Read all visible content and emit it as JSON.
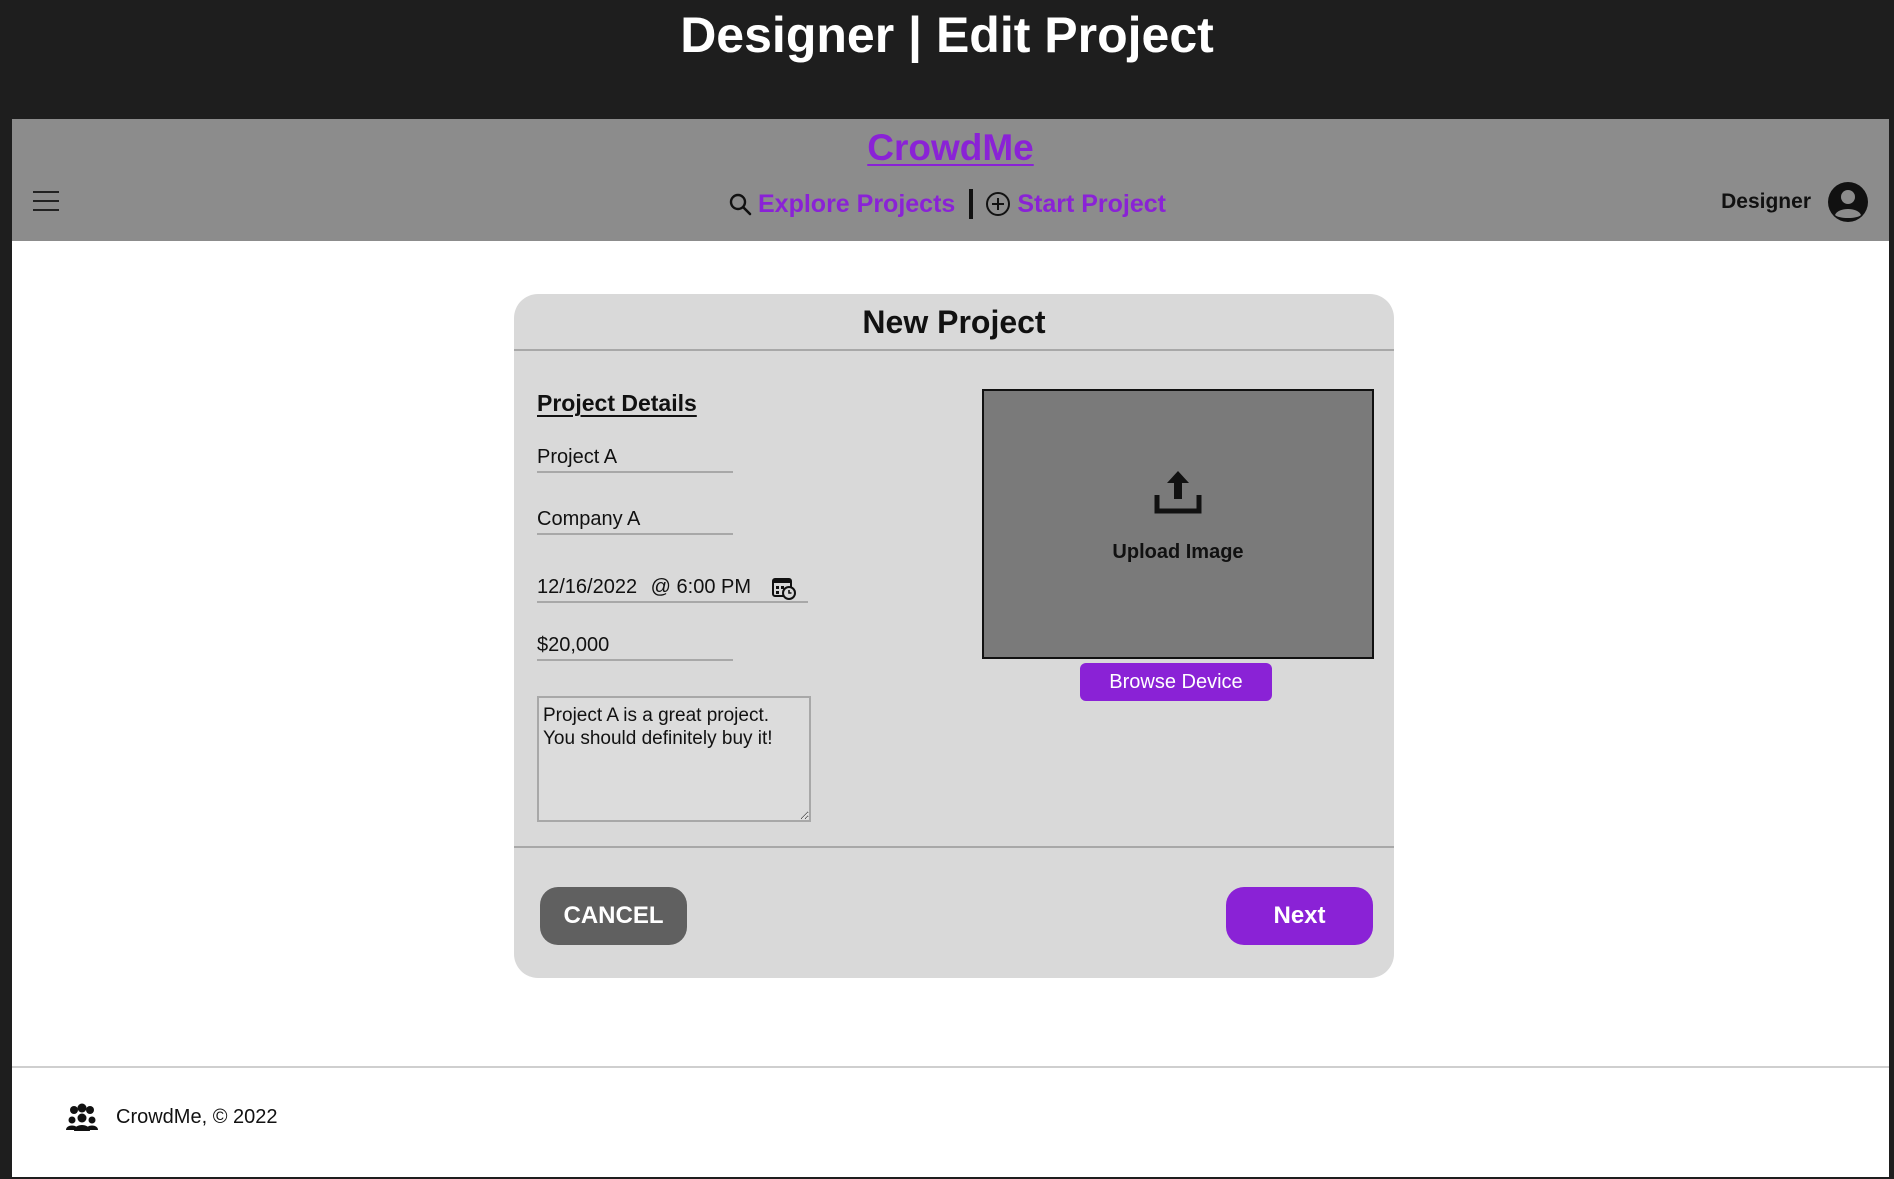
{
  "window": {
    "title": "Designer | Edit Project"
  },
  "header": {
    "brand": "CrowdMe",
    "nav": [
      {
        "label": "Explore Projects",
        "icon": "search-icon"
      },
      {
        "label": "Start Project",
        "icon": "plus-circle-icon"
      }
    ],
    "user": {
      "name": "Designer",
      "icon": "user-avatar-icon"
    },
    "menu_icon": "hamburger-menu-icon"
  },
  "card": {
    "title": "New Project",
    "section_title": "Project Details",
    "fields": {
      "project_name": "Project A",
      "company_name": "Company A",
      "date": "12/16/2022",
      "time": "@ 6:00 PM",
      "goal": "$20,000",
      "description": "Project A is a great project. You should definitely buy it!"
    },
    "upload": {
      "label": "Upload Image",
      "browse_label": "Browse Device"
    },
    "actions": {
      "cancel_label": "CANCEL",
      "next_label": "Next"
    }
  },
  "footer": {
    "text": "CrowdMe, © 2022",
    "icon": "people-group-icon"
  },
  "colors": {
    "accent": "#8a22d6",
    "header_bg": "#8c8c8c",
    "card_bg": "#d9d9d9",
    "dropzone_bg": "#7a7a7a",
    "cancel_bg": "#606060",
    "outer_bg": "#1e1e1e"
  }
}
